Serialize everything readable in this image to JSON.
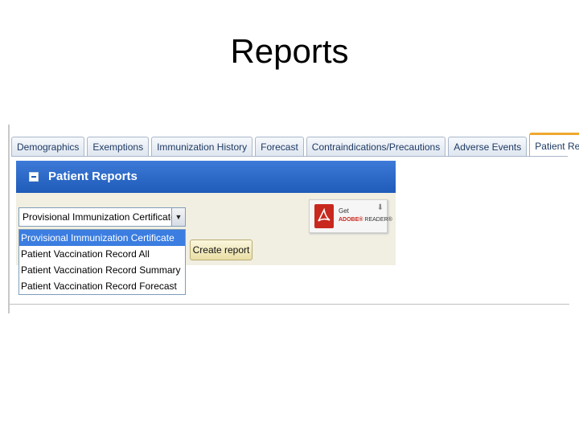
{
  "slide": {
    "title": "Reports"
  },
  "tabs": [
    {
      "label": "Demographics",
      "active": false
    },
    {
      "label": "Exemptions",
      "active": false
    },
    {
      "label": "Immunization History",
      "active": false
    },
    {
      "label": "Forecast",
      "active": false
    },
    {
      "label": "Contraindications/Precautions",
      "active": false
    },
    {
      "label": "Adverse Events",
      "active": false
    },
    {
      "label": "Patient Reports",
      "active": true
    }
  ],
  "panel": {
    "title": "Patient Reports",
    "header_color": "#2a66c6",
    "report_select": {
      "selected": "Provisional Immunization Certificate",
      "options": [
        "Provisional Immunization Certificate",
        "Patient Vaccination Record All",
        "Patient Vaccination Record Summary",
        "Patient Vaccination Record Forecast"
      ],
      "highlighted_index": 0
    },
    "create_button": "Create report",
    "adobe": {
      "get": "Get",
      "brand": "ADOBE®",
      "product": "READER®"
    }
  }
}
